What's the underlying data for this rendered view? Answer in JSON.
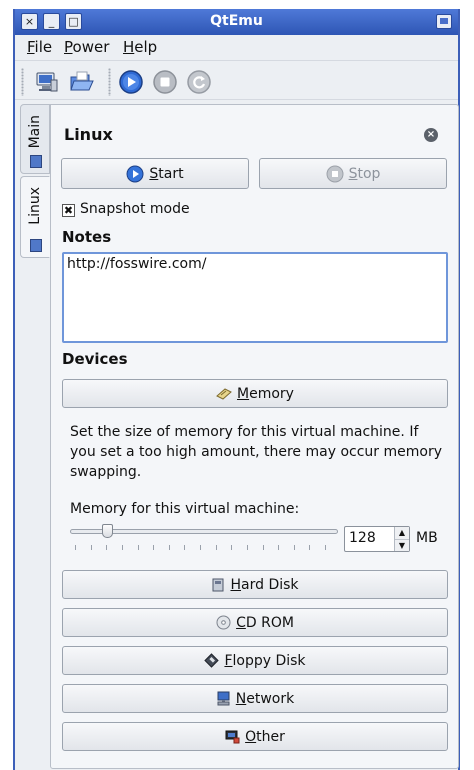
{
  "window": {
    "title": "QtEmu",
    "controls": [
      "×",
      "_",
      "□"
    ]
  },
  "menu": {
    "items": [
      {
        "underline": "F",
        "rest": "ile"
      },
      {
        "underline": "P",
        "rest": "ower"
      },
      {
        "underline": "H",
        "rest": "elp"
      }
    ]
  },
  "toolbar": {
    "icons": [
      "new-machine-icon",
      "open-folder-icon",
      "start-icon",
      "stop-icon",
      "restart-icon"
    ]
  },
  "tabs": {
    "main": "Main",
    "linux": "Linux"
  },
  "machine": {
    "name": "Linux",
    "start_underline": "S",
    "start_rest": "tart",
    "stop_underline": "S",
    "stop_rest": "top",
    "snapshot_label": "Snapshot mode",
    "snapshot_checked": true,
    "notes_label": "Notes",
    "notes_value": "http://fosswire.com/",
    "devices_label": "Devices"
  },
  "memory": {
    "button_underline": "M",
    "button_rest": "emory",
    "description": "Set the size of memory for this virtual machine. If you set a too high amount, there may occur memory swapping.",
    "slider_label": "Memory for this virtual machine:",
    "value": "128",
    "unit": "MB",
    "slider_fraction": 0.14
  },
  "devices": [
    {
      "underline": "H",
      "rest": "ard Disk",
      "icon": "hard-disk-icon"
    },
    {
      "underline": "C",
      "rest": "D ROM",
      "icon": "cdrom-icon"
    },
    {
      "underline": "F",
      "rest": "loppy Disk",
      "icon": "floppy-icon"
    },
    {
      "underline": "N",
      "rest": "etwork",
      "icon": "network-icon"
    },
    {
      "underline": "O",
      "rest": "ther",
      "icon": "other-icon"
    }
  ],
  "colors": {
    "titlebar": "#3a63c6",
    "focus": "#6f96da"
  }
}
